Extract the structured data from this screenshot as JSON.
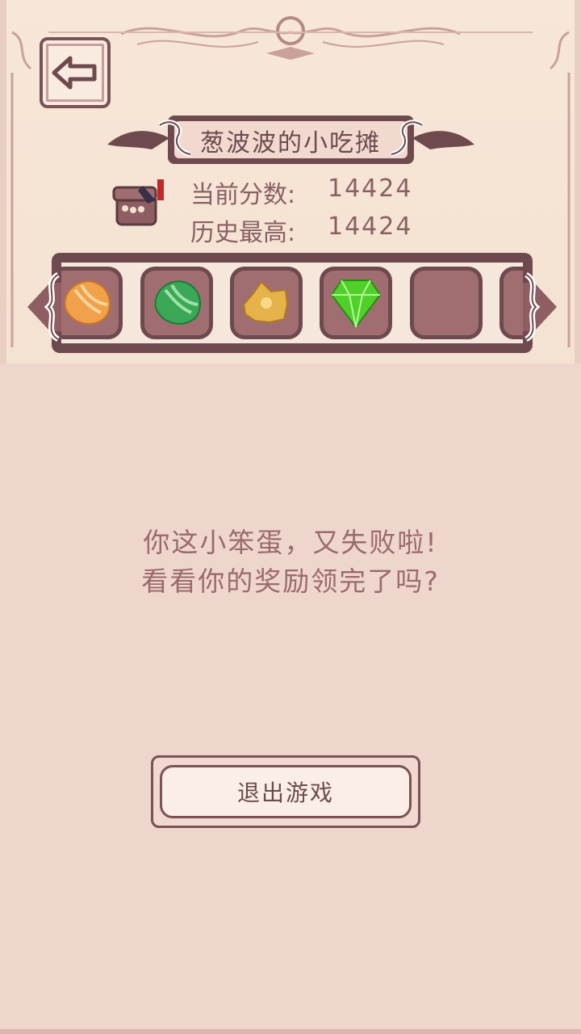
{
  "header": {
    "back_icon": "left-arrow-icon",
    "title": "葱波波的小吃摊"
  },
  "stats": {
    "current_label": "当前分数:",
    "current_value": "14424",
    "best_label": "历史最高:",
    "best_value": "14424",
    "icon": "gift-box-icon"
  },
  "tray": {
    "slots": [
      {
        "item": "orange-candy-icon"
      },
      {
        "item": "green-candy-icon"
      },
      {
        "item": "golden-nugget-icon"
      },
      {
        "item": "green-gem-icon"
      },
      {
        "item": "empty-slot"
      },
      {
        "item": "empty-slot"
      }
    ]
  },
  "dialog": {
    "line1": "你这小笨蛋，又失败啦!",
    "line2": "看看你的奖励领完了吗?",
    "exit_label": "退出游戏"
  },
  "colors": {
    "panel": "#efd6cc",
    "frame": "#6e4a4f",
    "text": "#9a6a6d",
    "slot": "#a06e71"
  }
}
